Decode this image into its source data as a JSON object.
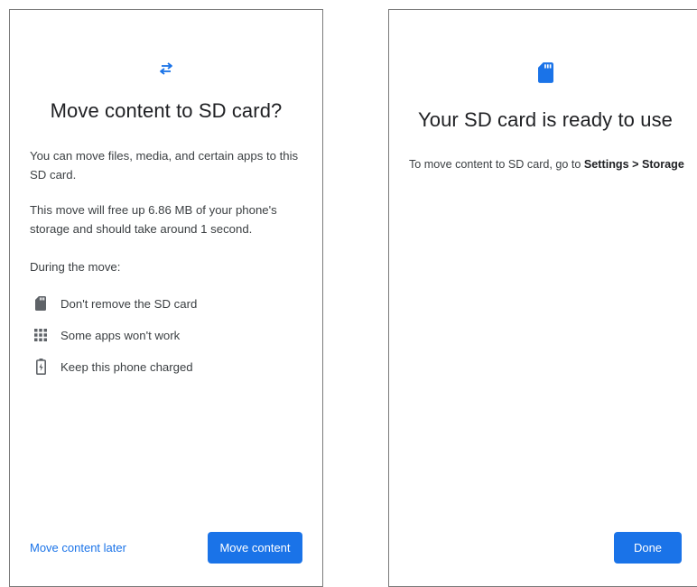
{
  "colors": {
    "accent": "#1a73e8",
    "text_primary": "#202124",
    "text_secondary": "#3c4043",
    "icon_gray": "#5f6368",
    "frame_border": "#7a7a7a"
  },
  "left_screen": {
    "header_icon": "swap-arrows-icon",
    "title": "Move content to SD card?",
    "intro": "You can move files, media, and certain apps to this SD card.",
    "free_up_text": "This move will free up 6.86 MB of your phone's storage and should take around 1 second.",
    "during_label": "During the move:",
    "items": [
      {
        "icon": "sd-card-icon",
        "label": "Don't remove the SD card"
      },
      {
        "icon": "apps-grid-icon",
        "label": "Some apps won't work"
      },
      {
        "icon": "battery-charging-icon",
        "label": "Keep this phone charged"
      }
    ],
    "later_button": "Move content later",
    "move_button": "Move content"
  },
  "right_screen": {
    "header_icon": "sd-card-icon",
    "title": "Your SD card is ready to use",
    "message_prefix": "To move content to SD card, go to ",
    "message_bold": "Settings > Storage",
    "done_button": "Done"
  }
}
